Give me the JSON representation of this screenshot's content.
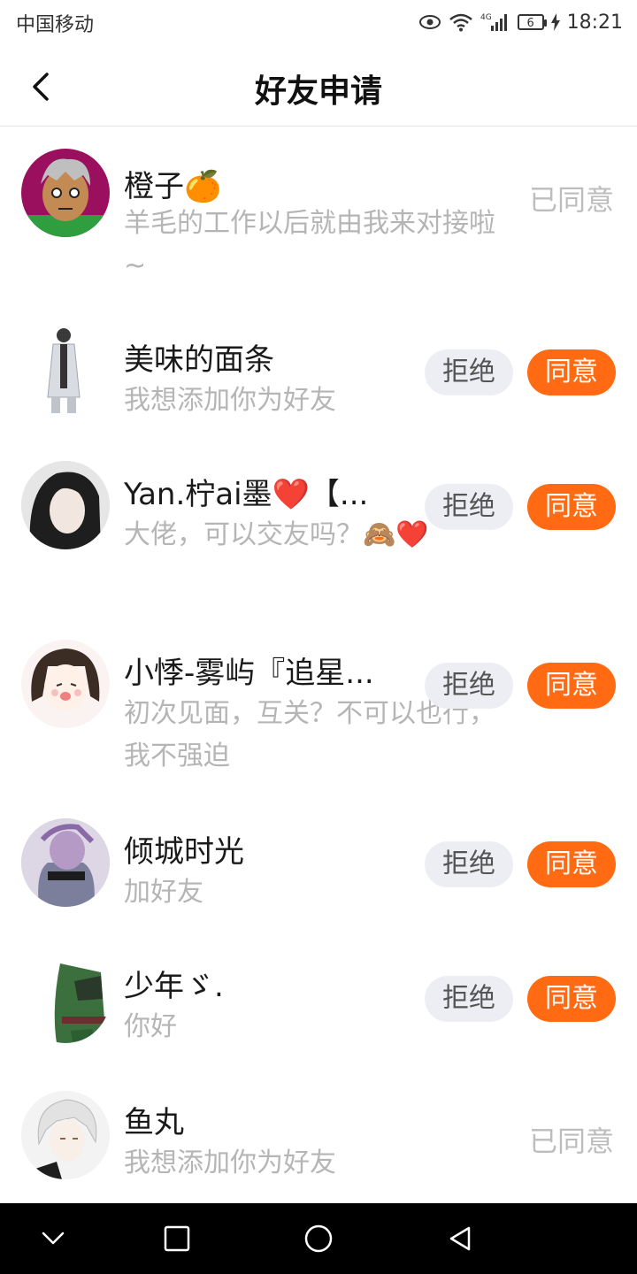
{
  "status_bar": {
    "carrier": "中国移动",
    "network": "4G",
    "battery": "6",
    "time": "18:21"
  },
  "header": {
    "title": "好友申请"
  },
  "requests": [
    {
      "name": "橙子🍊",
      "message": "羊毛的工作以后就由我来对接啦~",
      "status": "已同意"
    },
    {
      "name": "美味的面条",
      "message": "我想添加你为好友",
      "reject": "拒绝",
      "accept": "同意"
    },
    {
      "name": "Yan.柠ai墨❤️【...",
      "message": "大佬，可以交友吗？🙈❤️",
      "reject": "拒绝",
      "accept": "同意"
    },
    {
      "name": "小悸-雾屿『追星...",
      "message": "初次见面，互关？不可以也行，我不强迫",
      "reject": "拒绝",
      "accept": "同意"
    },
    {
      "name": "倾城时光",
      "message": "加好友",
      "reject": "拒绝",
      "accept": "同意"
    },
    {
      "name": "少年ゞ.",
      "message": "你好",
      "reject": "拒绝",
      "accept": "同意"
    },
    {
      "name": "鱼丸",
      "message": "我想添加你为好友",
      "status": "已同意"
    }
  ],
  "colors": {
    "accent": "#ff6a13",
    "reject_bg": "#eceef4",
    "muted": "#b5b5b5"
  }
}
